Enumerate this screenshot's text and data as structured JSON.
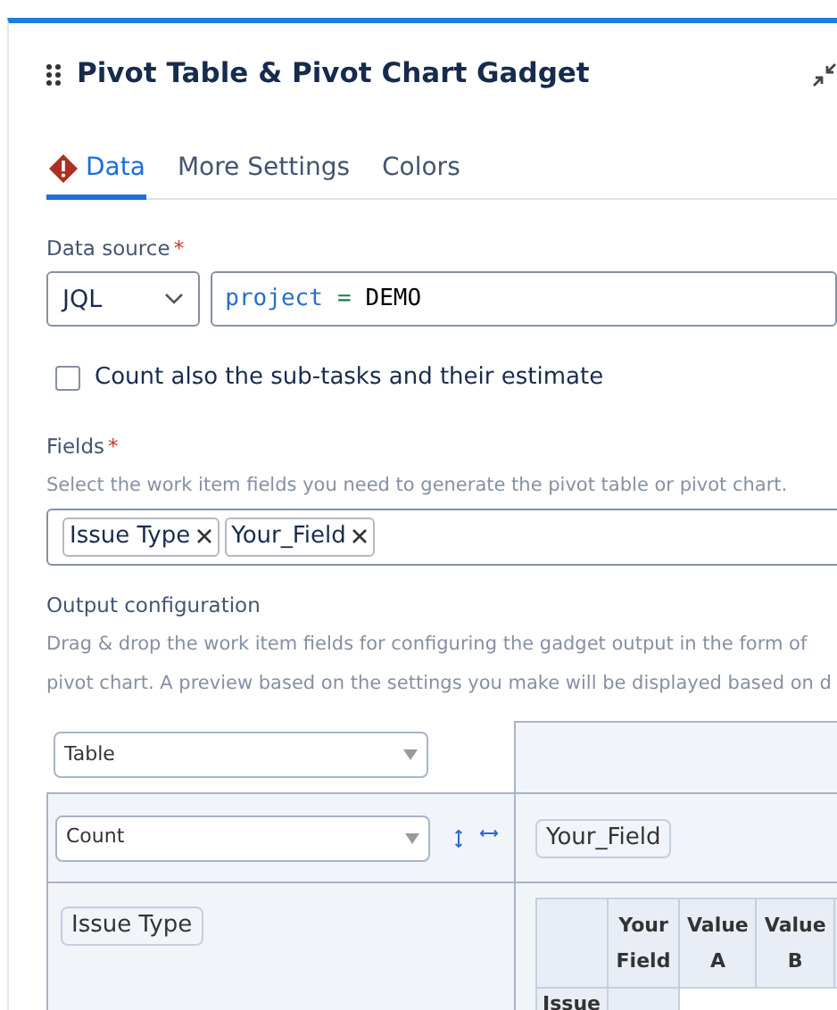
{
  "gadget": {
    "title": "Pivot Table & Pivot Chart Gadget"
  },
  "tabs": [
    {
      "label": "Data",
      "selected": true,
      "error": true
    },
    {
      "label": "More Settings",
      "selected": false,
      "error": false
    },
    {
      "label": "Colors",
      "selected": false,
      "error": false
    }
  ],
  "data_source": {
    "label": "Data source",
    "required": true,
    "required_mark": "*",
    "type": "JQL",
    "query_keyword": "project",
    "query_operator": "=",
    "query_value": "DEMO"
  },
  "subtasks_checkbox": {
    "label": "Count also the sub-tasks and their estimate",
    "checked": false
  },
  "fields": {
    "label": "Fields",
    "required": true,
    "required_mark": "*",
    "hint": "Select the work item fields you need to generate the pivot table or pivot chart.",
    "tags": [
      "Issue Type",
      "Your_Field"
    ]
  },
  "output": {
    "label": "Output configuration",
    "description": [
      "Drag & drop the work item fields for configuring the gadget output in the form of",
      "pivot chart. A preview based on the settings you make will be displayed based on d"
    ],
    "view_select": "Table",
    "measure_select": "Count",
    "column_field": "Your_Field",
    "row_field": "Issue Type",
    "preview_headers": [
      "Your Field",
      "Value A",
      "Value B"
    ],
    "preview_row_header": "Issue"
  }
}
